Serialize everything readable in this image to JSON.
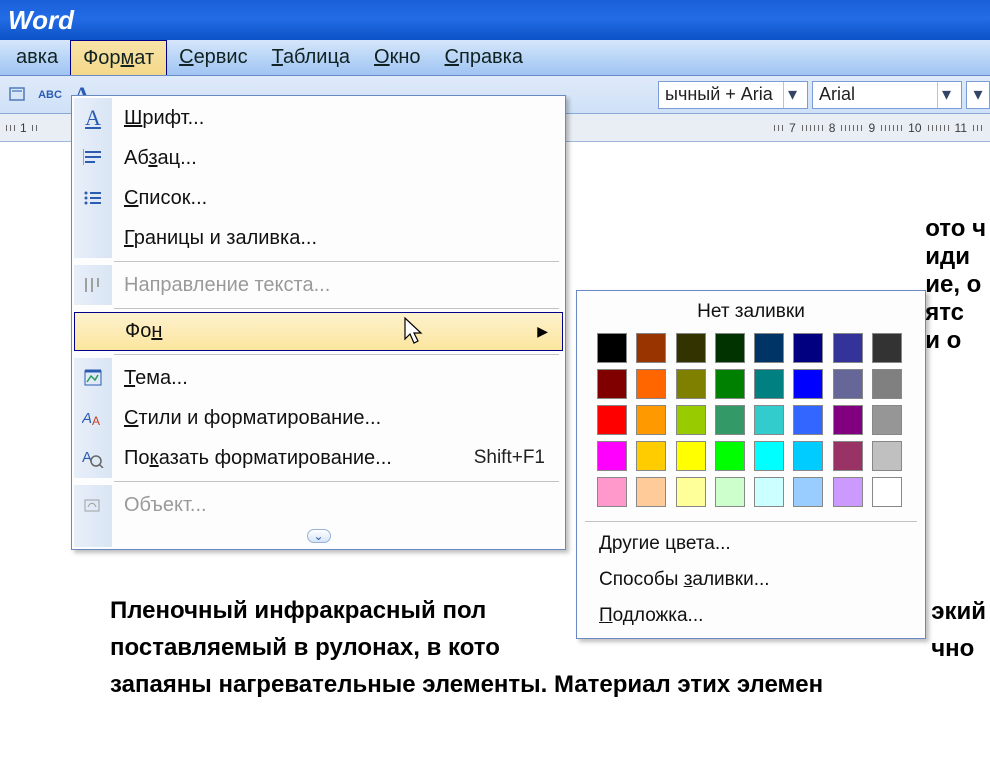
{
  "title": "Word",
  "menubar": {
    "items": [
      {
        "label": "авка",
        "underline": -1
      },
      {
        "label": "Формат",
        "underline": 3
      },
      {
        "label": "Сервис",
        "underline": 0
      },
      {
        "label": "Таблица",
        "underline": 0
      },
      {
        "label": "Окно",
        "underline": 0
      },
      {
        "label": "Справка",
        "underline": 0
      }
    ],
    "open_index": 1
  },
  "toolbar": {
    "style_value": "ычный + Aria",
    "font_value": "Arial"
  },
  "ruler_numbers": [
    "7",
    "8",
    "9",
    "10",
    "11"
  ],
  "dropdown": {
    "items": [
      {
        "label": "Шрифт...",
        "ul": 0,
        "icon": "A",
        "icon_color": "#2a5cb3"
      },
      {
        "label": "Абзац...",
        "ul": 2,
        "icon": "para"
      },
      {
        "label": "Список...",
        "ul": 0,
        "icon": "list"
      },
      {
        "label": "Границы и заливка...",
        "ul": 0
      },
      {
        "sep": true
      },
      {
        "label": "Направление текста...",
        "ul": -1,
        "icon": "dir",
        "disabled": true
      },
      {
        "sep": true
      },
      {
        "label": "Фон",
        "ul": 2,
        "submenu": true,
        "hover": true
      },
      {
        "sep": true
      },
      {
        "label": "Тема...",
        "ul": 0,
        "icon": "theme"
      },
      {
        "label": "Стили и форматирование...",
        "ul": 0,
        "icon": "styles"
      },
      {
        "label": "Показать форматирование...",
        "ul": 2,
        "icon": "reveal",
        "shortcut": "Shift+F1"
      },
      {
        "sep": true
      },
      {
        "label": "Объект...",
        "ul": -1,
        "icon": "object",
        "disabled": true
      }
    ]
  },
  "color_submenu": {
    "title": "Нет заливки",
    "colors": [
      "#000000",
      "#993300",
      "#333300",
      "#003300",
      "#003366",
      "#000080",
      "#333399",
      "#333333",
      "#800000",
      "#ff6600",
      "#808000",
      "#008000",
      "#008080",
      "#0000ff",
      "#666699",
      "#808080",
      "#ff0000",
      "#ff9900",
      "#99cc00",
      "#339966",
      "#33cccc",
      "#3366ff",
      "#800080",
      "#969696",
      "#ff00ff",
      "#ffcc00",
      "#ffff00",
      "#00ff00",
      "#00ffff",
      "#00ccff",
      "#993366",
      "#c0c0c0",
      "#ff99cc",
      "#ffcc99",
      "#ffff99",
      "#ccffcc",
      "#ccffff",
      "#99ccff",
      "#cc99ff",
      "#ffffff"
    ],
    "more_colors": "Другие цвета...",
    "more_colors_ul": 0,
    "fill_effects": "Способы заливки...",
    "fill_effects_ul": 8,
    "watermark": "Подложка...",
    "watermark_ul": 0
  },
  "document": {
    "frags_right": [
      "ото ч",
      "иди",
      "ие, о",
      "ятс",
      "и о"
    ],
    "main_lines": [
      "Пленочный инфракрасный пол",
      "поставляемый в рулонах, в кото",
      "запаяны нагревательные элементы. Материал этих элемен"
    ],
    "main_tail_right": [
      "          экий",
      "          чно"
    ]
  }
}
